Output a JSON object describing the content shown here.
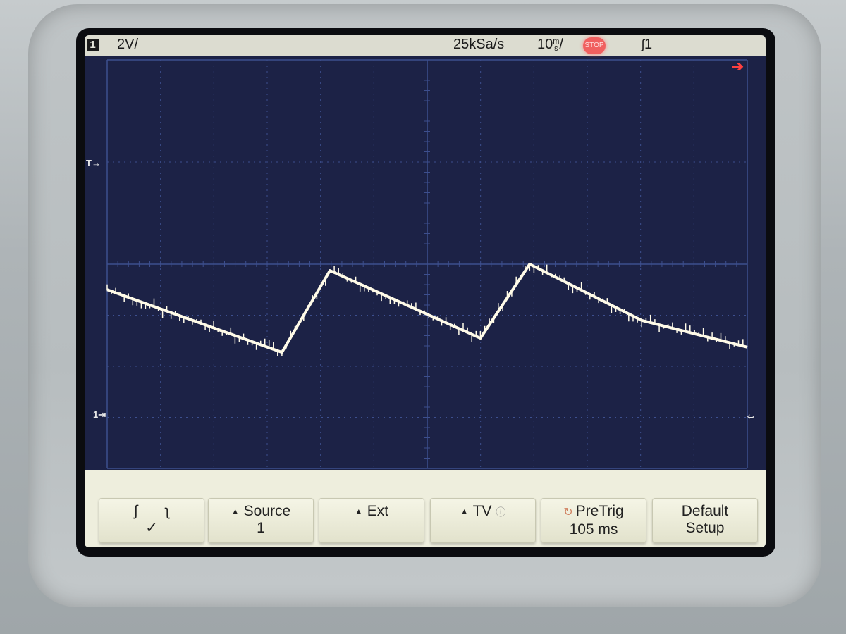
{
  "status": {
    "channel": "1",
    "scale": "2V/",
    "sample_rate": "25kSa/s",
    "timebase_num": "10",
    "timebase_unit_top": "m",
    "timebase_unit_bottom": "s",
    "timebase_slash": "/",
    "run_state": "STOP",
    "trigger": "1"
  },
  "softkeys": {
    "slope_check": "✓",
    "source_label": "Source",
    "source_value": "1",
    "ext_label": "Ext",
    "tv_label": "TV",
    "pretrig_label": "PreTrig",
    "pretrig_value": "105 ms",
    "default_line1": "Default",
    "default_line2": "Setup"
  },
  "colors": {
    "screen_bg": "#1c2246",
    "grid": "#3d4f8e",
    "trace": "#fffbe8",
    "trigger_marker": "#ff4040",
    "status_bar": "#dcdcd0",
    "softkey_bar": "#eeeedd"
  },
  "chart_data": {
    "type": "line",
    "title": "",
    "xlabel": "",
    "ylabel": "",
    "xlim": [
      -50,
      50
    ],
    "ylim": [
      -8,
      8
    ],
    "grid": true,
    "series": [
      {
        "x": [
          -50,
          -22.7,
          -15.2,
          8.3,
          16.0,
          33.5,
          50
        ],
        "y": [
          -1.0,
          -3.45,
          -0.25,
          -2.9,
          0.0,
          -2.2,
          -3.25
        ]
      }
    ]
  }
}
